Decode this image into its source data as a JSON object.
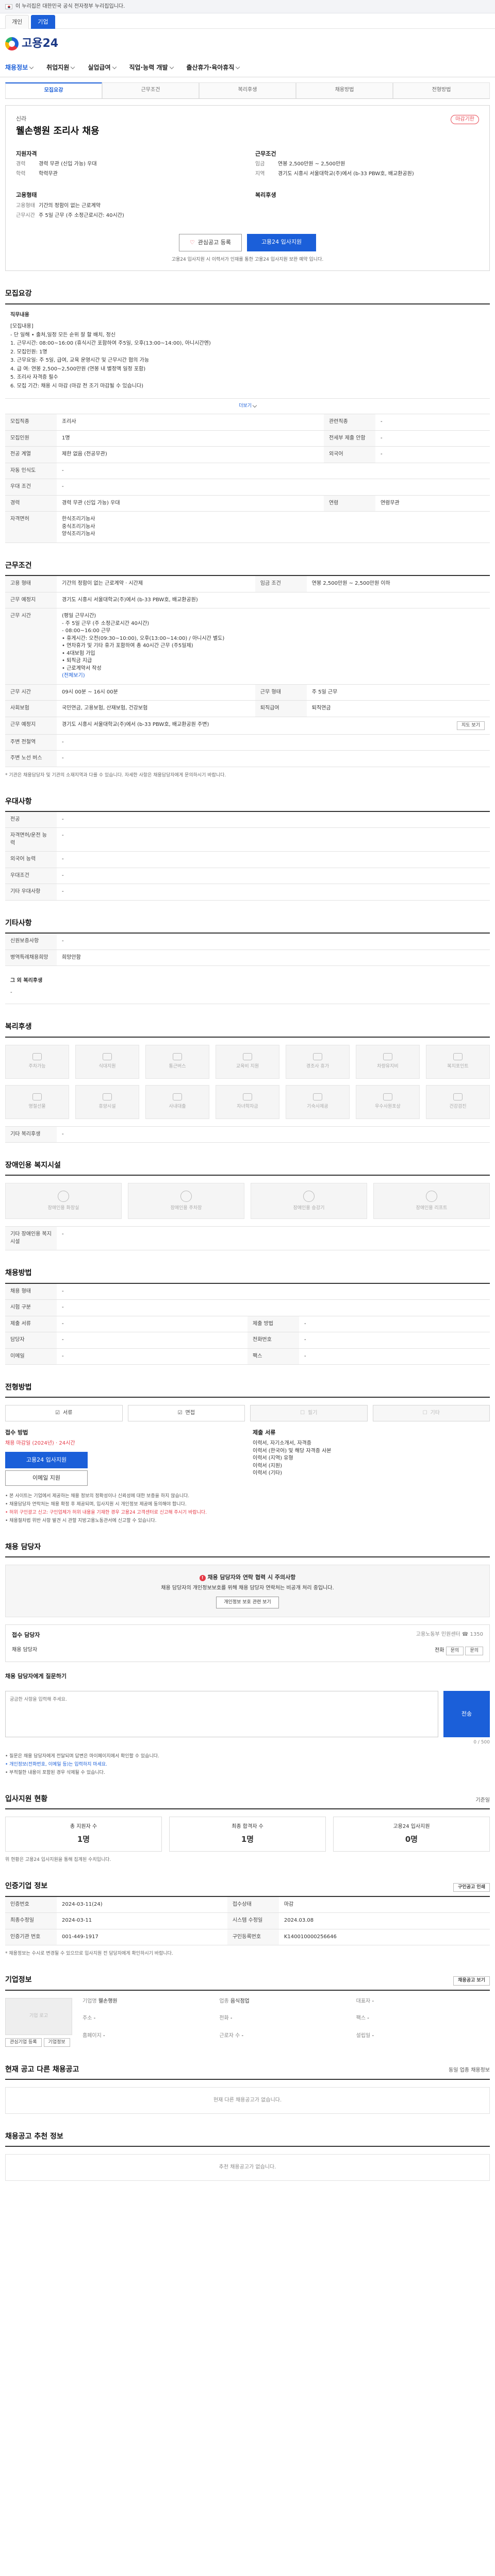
{
  "gov_banner": "이 누리집은 대한민국 공식 전자정부 누리집입니다.",
  "top_tabs": [
    "개인",
    "기업"
  ],
  "logo_text": "고용24",
  "gnb": [
    "채용정보",
    "취업지원",
    "실업급여",
    "직업·능력 개발",
    "출산휴가·육아휴직"
  ],
  "sub_tabs": [
    "모집요강",
    "근무조건",
    "복리후생",
    "채용방법",
    "전형방법"
  ],
  "job": {
    "company": "신라",
    "title": "웰손행원 조리사 채용",
    "badge": "마감기한",
    "qual_title": "지원자격",
    "qual": [
      {
        "k": "경력",
        "v": "경력 무관 (신입 가능) 우대"
      },
      {
        "k": "학력",
        "v": "학력무관"
      }
    ],
    "cond_title": "근무조건",
    "cond": [
      {
        "k": "임금",
        "v": "연봉 2,500만원 ~ 2,500만원"
      },
      {
        "k": "지역",
        "v": "경기도 시흥시 서울대학교(주)에서 (b-33 PBW호, 배교환공원)"
      }
    ],
    "form_title": "고용형태",
    "form": [
      {
        "k": "고용형태",
        "v": "기간의 정함이 없는 근로계약"
      },
      {
        "k": "근무시간",
        "v": "주 5일 근무 (주 소정근로시간: 40시간)"
      }
    ],
    "welfare_title": "복리후생",
    "save_btn": "관심공고 등록",
    "apply_btn": "고용24 입사지원",
    "note": "고용24 입사지원 시 이력서가 인재를 통한 고용24 입사지원 보완 예약 입니다."
  },
  "recruit": {
    "title": "모집요강",
    "duty_label": "직무내용",
    "duty": [
      "[모집내용]",
      "- 단 일해 • 출처,일정 모든 순위 잘 할 배치, 정신",
      "",
      "1. 근무시간: 08:00~16:00 (휴식시간 포함하여 주5일, 오후(13:00~14:00), 아니시간엔)",
      "2. 모집인원: 1명",
      "3. 근무요일: 주 5일, 급여, 교육 운영시간 및 근무시간 협의 가능",
      "4. 급 여: 연봉 2,500~2,500만원 (연봉 내 별정액 일정 포함)",
      "5. 조리사 자격증 필수",
      "6. 모집 기간: 채용 시 마감 (마감 전 조기 마감될 수 있습니다)"
    ],
    "more": "더보기",
    "rows": [
      {
        "k": "모집직종",
        "v": "조리사",
        "k2": "관련직종",
        "v2": "-"
      },
      {
        "k": "모집인원",
        "v": "1명",
        "k2": "전세부 제출 안함",
        "v2": "-"
      },
      {
        "k": "전공 계열",
        "v": "제한 없음 (전공무관)",
        "k2": "외국어",
        "v2": "-"
      },
      {
        "k": "자동 인식도",
        "v": "-",
        "k2": "",
        "v2": ""
      },
      {
        "k": "우대 조건",
        "v": "-",
        "k2": "",
        "v2": ""
      },
      {
        "k": "경력",
        "v": "경력 무관 (신입 가능) 우대",
        "k2": "연령",
        "v2": "연령무관"
      }
    ],
    "certs": [
      "한식조리기능사",
      "중식조리기능사",
      "양식조리기능사"
    ]
  },
  "work": {
    "title": "근무조건",
    "rows": [
      {
        "k": "고용 형태",
        "v": "기간의 정함이 없는 근로계약 · 시간제",
        "k2": "임금 조건",
        "v2": "연봉 2,500만원 ~ 2,500만원 이하"
      },
      {
        "k": "근무 예정지",
        "v": "경기도 시흥시 서울대학교(주)에서 (b-33 PBW호, 배교환공원)",
        "k2": "",
        "v2": ""
      }
    ],
    "hours_label": "근무 시간",
    "hours": [
      "(평일 근무시간)",
      "- 주 5일 근무 (주 소정근로시간 40시간)",
      "- 08:00~16:00 근무",
      "• 휴게시간: 오전(09:30~10:00), 오후(13:00~14:00) / 아니시간 별도)",
      "• 연차휴가 및 기타 휴가 포함하여 총 40시간 근무 (주5일제)",
      "• 4대보험 가입",
      "• 퇴직금 지급",
      "• 근로계약서 작성",
      "(전체보기)"
    ],
    "rows2": [
      {
        "k": "근무 시간",
        "v": "09시 00분 ~ 16시 00분",
        "k2": "근무 형태",
        "v2": "주 5일 근무"
      },
      {
        "k": "사회보험",
        "v": "국민연금, 고용보험, 산재보험, 건강보험",
        "k2": "퇴직급여",
        "v2": "퇴직연금"
      },
      {
        "k": "근무 예정지",
        "v": "경기도 시흥시 서울대학교(주)에서 (b-33 PBW호, 배교환공원 주변)",
        "k2": "",
        "v2": ""
      },
      {
        "k": "주변 전철역",
        "v": "-",
        "k2": "",
        "v2": ""
      },
      {
        "k": "주변 노선 버스",
        "v": "-",
        "k2": "",
        "v2": ""
      }
    ],
    "map_btn": "지도 보기",
    "footnote": "* 기관은 채용담당자 및 기관의 소재지역과 다를 수 있습니다. 자세한 사항은 채용담당자에게 문의하시기 바랍니다."
  },
  "pref": {
    "title": "우대사항",
    "rows": [
      {
        "k": "전공",
        "v": "-"
      },
      {
        "k": "자격면허/운전 능력",
        "v": "-"
      },
      {
        "k": "외국어 능력",
        "v": "-"
      },
      {
        "k": "우대조건",
        "v": "-"
      },
      {
        "k": "기타 우대사항",
        "v": "-"
      }
    ]
  },
  "other": {
    "title": "기타사항",
    "rows": [
      {
        "k": "신원보증사항",
        "v": "-"
      },
      {
        "k": "병역특례채용희망",
        "v": "희망안함"
      }
    ],
    "extra_k": "그 외 복리후생",
    "extra_v": "-"
  },
  "welfare": {
    "title": "복리후생",
    "items": [
      "주차가능",
      "식대지원",
      "통근버스",
      "교육비 지원",
      "경조사 휴가",
      "차량유지비",
      "복지포인트",
      "명절선물",
      "휴양시설",
      "사내대출",
      "자녀학자금",
      "기숙사제공",
      "우수사원포상",
      "건강검진"
    ],
    "note_k": "기타 복리후생",
    "note_v": "-"
  },
  "disabled": {
    "title": "장애인용 복지시설",
    "items": [
      "장애인용 화장실",
      "장애인용 주차장",
      "장애인용 승강기",
      "장애인용 리프트"
    ],
    "note_k": "기타 장애인용 복지시설",
    "note_v": "-"
  },
  "selection": {
    "title": "채용방법",
    "rows": [
      {
        "k": "채용 형태",
        "v": "-",
        "k2": "",
        "v2": ""
      },
      {
        "k": "시험 구분",
        "v": "-",
        "k2": "",
        "v2": ""
      },
      {
        "k": "제출 서류",
        "v": "-",
        "k2": "제출 방법",
        "v2": "-"
      },
      {
        "k": "담당자",
        "v": "-",
        "k2": "전화번호",
        "v2": "-"
      },
      {
        "k": "이메일",
        "v": "-",
        "k2": "팩스",
        "v2": "-"
      }
    ]
  },
  "method": {
    "title": "전형방법",
    "items": [
      {
        "label": "서류",
        "off": false
      },
      {
        "label": "면접",
        "off": false
      },
      {
        "label": "필기",
        "off": true
      },
      {
        "label": "기타",
        "off": true
      }
    ],
    "apply_label": "접수 방법",
    "apply_sub": "채용 마감일 (2024년) · 24시간",
    "apply_btn": "고용24 입사지원",
    "apply_btn2": "이메일 지원",
    "doc_label": "제출 서류",
    "docs": [
      "이력서, 자기소개서, 자격증",
      "이력서 (한국어) 및 해당 자격증 사본",
      "이력서 (지역) 유형",
      "이력서 (지원)",
      "이력서 (기타)"
    ],
    "notes": [
      "본 사이트는 기업에서 제공하는 채용 정보의 정확성이나 신뢰성에 대한 보증을 하지 않습니다.",
      "채용담당자 연락처는 채용 확정 후 제공되며, 입사지원 시 개인정보 제공에 동의해야 합니다.",
      "허위 구인광고 신고: 구인업체가 허위 내용을 기재한 경우 고용24 고객센터로 신고해 주시기 바랍니다.",
      "채용절차법 위반 사항 발견 시 관할 지방고용노동관서에 신고할 수 있습니다."
    ]
  },
  "manager": {
    "title": "채용 담당자",
    "alert_title": "채용 담당자와 연락 협력 시 주의사항",
    "alert_text": "채용 담당자의 개인정보보호를 위해 채용 담당자 연락처는 비공개 처리 중입니다.",
    "alert_btn": "개인정보 보호 관련 보기",
    "contact_label": "접수 담당자",
    "contact_side": "고용노동부 민원센터 ☎ 1350",
    "contact_name": "채용 담당자",
    "contact_tel_label": "전화",
    "contact_btn1": "문의",
    "contact_btn2": "문의",
    "inq_label": "채용 담당자에게 질문하기",
    "inq_placeholder": "궁금한 사항을 입력해 주세요.",
    "inq_btn": "전송",
    "inq_count": "0 / 500",
    "inq_notes": [
      "질문은 채용 담당자에게 전달되며 답변은 마이페이지에서 확인할 수 있습니다.",
      "개인정보(전화번호, 이메일 등)는 입력하지 마세요.",
      "부적절한 내용이 포함된 경우 삭제될 수 있습니다."
    ]
  },
  "stats": {
    "title": "입사지원 현황",
    "side": "기준일",
    "items": [
      {
        "l": "총 지원자 수",
        "n": "1명"
      },
      {
        "l": "최종 합격자 수",
        "n": "1명"
      },
      {
        "l": "고용24 입사지원",
        "n": "0명"
      }
    ],
    "note": "위 현황은 고용24 입사지원을 통해 집계된 수치입니다."
  },
  "info": {
    "title": "인증기업 정보",
    "print_btn": "구인공고 인쇄",
    "rows": [
      {
        "k": "인증번호",
        "v": "2024-03-11(24)",
        "k2": "접수상태",
        "v2": "마감"
      },
      {
        "k": "최종수정일",
        "v": "2024-03-11",
        "k2": "시스템 수정일",
        "v2": "2024.03.08"
      },
      {
        "k": "인증기관 번호",
        "v": "001-449-1917",
        "k2": "구인등록번호",
        "v2": "K140010000256646"
      }
    ],
    "foot": "* 채용정보는 수시로 변경될 수 있으므로 입사지원 전 담당자에게 확인하시기 바랍니다."
  },
  "biz": {
    "title": "기업정보",
    "logo_text": "기업 로고",
    "fields": [
      {
        "k": "기업명",
        "v": "웰손행원"
      },
      {
        "k": "업종",
        "v": "음식점업"
      },
      {
        "k": "대표자",
        "v": "-"
      },
      {
        "k": "주소",
        "v": "-"
      },
      {
        "k": "전화",
        "v": "-"
      },
      {
        "k": "팩스",
        "v": "-"
      },
      {
        "k": "홈페이지",
        "v": "-"
      },
      {
        "k": "근로자 수",
        "v": "-"
      },
      {
        "k": "설립일",
        "v": "-"
      }
    ],
    "btn1": "관심기업 등록",
    "btn2": "기업정보",
    "btn3": "채용공고 보기"
  },
  "similar": {
    "title": "현재 공고 다른 채용공고",
    "side": "동일 업종 채용정보",
    "empty": "현재 다른 채용공고가 없습니다."
  },
  "reco": {
    "title": "채용공고 추천 정보",
    "empty": "추천 채용공고가 없습니다."
  }
}
